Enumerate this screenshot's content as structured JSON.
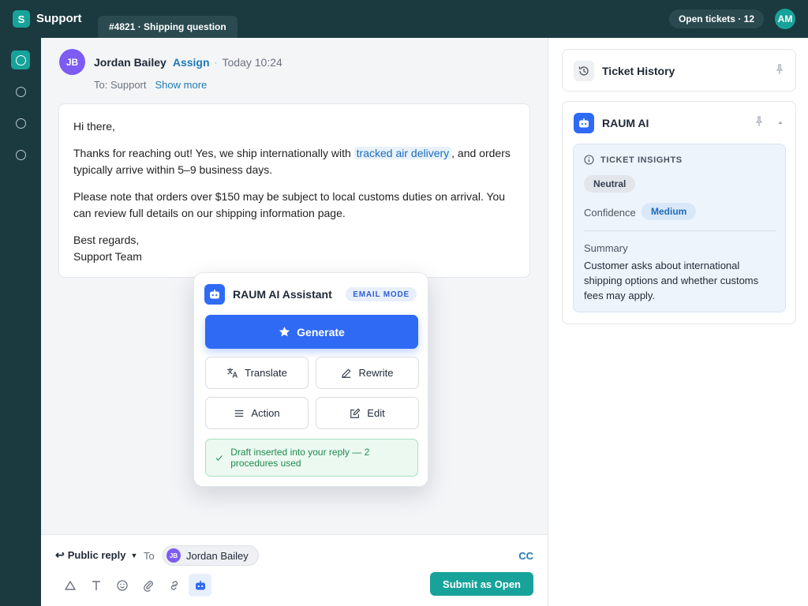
{
  "app": {
    "logo_letter": "S",
    "name": "Support"
  },
  "ticket_tab": "#4821 · Shipping question",
  "header": {
    "open_tickets": "Open tickets · 12",
    "user_initials": "AM"
  },
  "message": {
    "sender_initials": "JB",
    "sender_name": "Jordan Bailey",
    "assign_label": "Assign",
    "separator": "·",
    "time": "Today 10:24",
    "to_text": "To: Support",
    "show_more": "Show more",
    "greeting": "Hi there,",
    "p1_before": "Thanks for reaching out! Yes, we ship internationally with ",
    "p1_highlight": "tracked air delivery",
    "p1_after": ", and orders typically arrive within 5–9 business days.",
    "p2": "Please note that orders over $150 may be subject to local customs duties on arrival. You can review full details on our shipping information page.",
    "signoff": "Best regards,",
    "signature": "Support Team"
  },
  "composer": {
    "reply_type": "Public reply",
    "to_label": "To",
    "recipient_initials": "JB",
    "recipient_name": "Jordan Bailey",
    "cc_label": "CC",
    "submit_label": "Submit as Open"
  },
  "right_panel": {
    "history_title": "Ticket History",
    "raum_title": "RAUM AI",
    "insights_title": "TICKET INSIGHTS",
    "sentiment": "Neutral",
    "confidence_label": "Confidence",
    "confidence_value": "Medium",
    "summary_label": "Summary",
    "summary_text": "Customer asks about international shipping options and whether customs fees may apply."
  },
  "assistant": {
    "title": "RAUM AI Assistant",
    "mode_badge": "EMAIL MODE",
    "generate_label": "Generate",
    "translate_label": "Translate",
    "rewrite_label": "Rewrite",
    "action_label": "Action",
    "edit_label": "Edit",
    "status_text": "Draft inserted into your reply — 2 procedures used"
  },
  "colors": {
    "accent": "#17a39a",
    "ai_blue": "#2f6af5",
    "sidebar": "#1b3a40",
    "link": "#1e7ab8"
  },
  "icons": {
    "rail": [
      "home-circle-icon",
      "inbox-circle-icon",
      "contacts-circle-icon",
      "reports-circle-icon"
    ],
    "toolbar": [
      "shape-icon",
      "text-format-icon",
      "emoji-icon",
      "attachment-icon",
      "link-icon",
      "ai-bot-icon"
    ]
  }
}
